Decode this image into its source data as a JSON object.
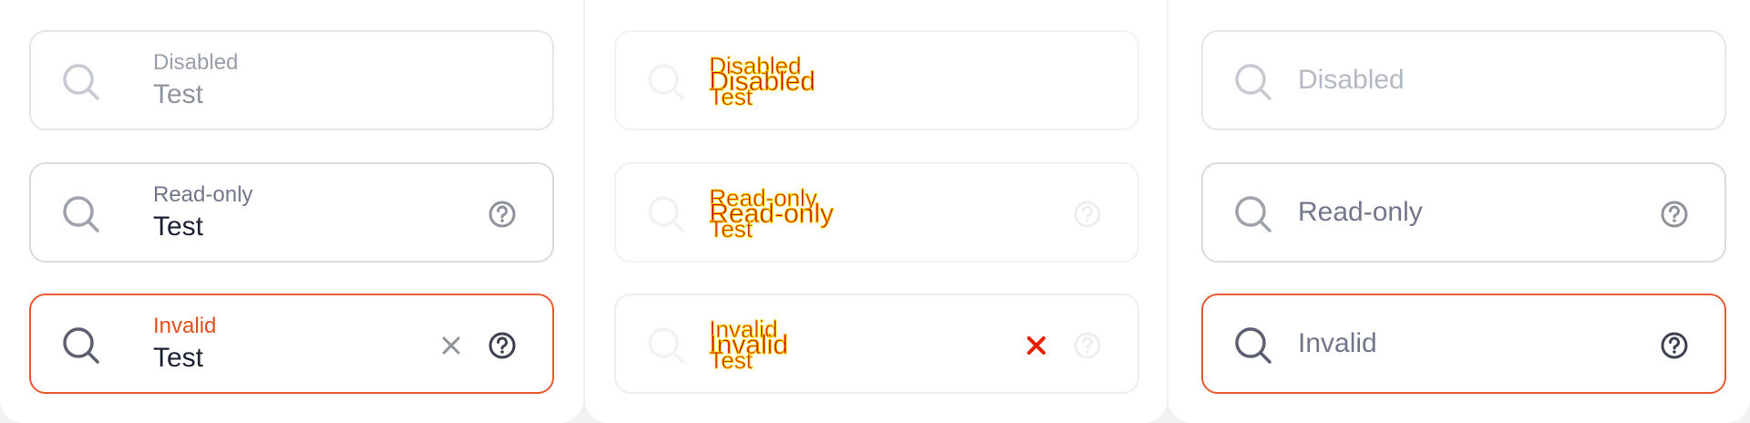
{
  "columns": [
    {
      "fields": [
        {
          "label": "Disabled",
          "value": "Test"
        },
        {
          "label": "Read-only",
          "value": "Test"
        },
        {
          "label": "Invalid",
          "value": "Test"
        }
      ]
    },
    {
      "fields": [
        {
          "label": "Disabled",
          "label_large": "Disabled",
          "value": "Test"
        },
        {
          "label": "Read-only",
          "label_large": "Read-only",
          "value": "Test"
        },
        {
          "label": "Invalid",
          "label_large": "Invalid",
          "value": "Test"
        }
      ]
    },
    {
      "fields": [
        {
          "placeholder": "Disabled"
        },
        {
          "placeholder": "Read-only"
        },
        {
          "placeholder": "Invalid"
        }
      ]
    }
  ],
  "colors": {
    "border": "#e4e6ea",
    "invalid": "#ea5a2e",
    "text_dark": "#1c2033",
    "text_muted": "#71768a",
    "icon": "#8e939c"
  },
  "icons": {
    "search": "search-icon",
    "help": "question-circle-icon",
    "clear": "close-icon"
  }
}
